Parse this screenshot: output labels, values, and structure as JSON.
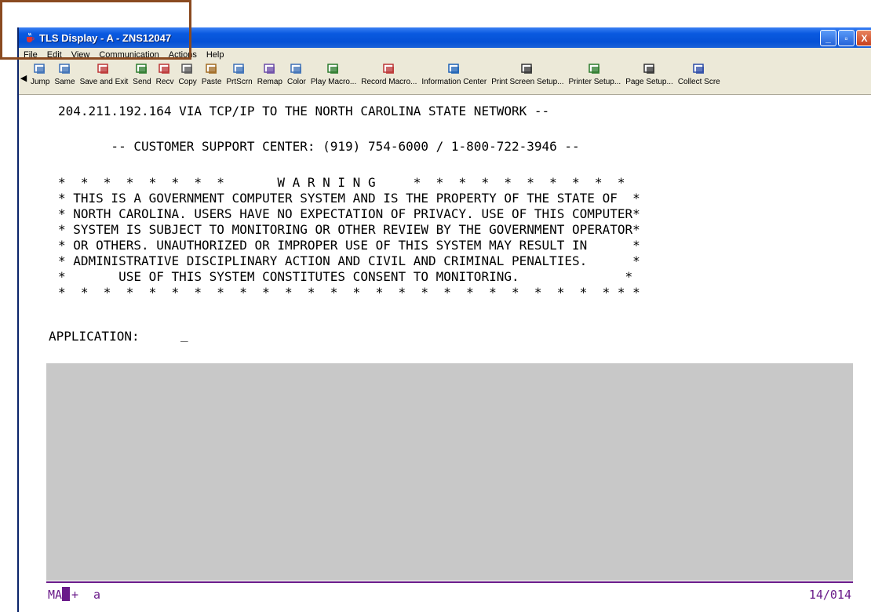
{
  "window": {
    "title": "TLS Display - A - ZNS12047",
    "controls": {
      "minimize": "_",
      "maximize": "▫",
      "close": "X"
    }
  },
  "menubar": [
    "File",
    "Edit",
    "View",
    "Communication",
    "Actions",
    "Help"
  ],
  "toolbar": [
    {
      "label": "Jump",
      "icon": "jump-icon"
    },
    {
      "label": "Same",
      "icon": "same-icon"
    },
    {
      "label": "Save and Exit",
      "icon": "save-exit-icon"
    },
    {
      "label": "Send",
      "icon": "send-icon"
    },
    {
      "label": "Recv",
      "icon": "receive-icon"
    },
    {
      "label": "Copy",
      "icon": "copy-icon"
    },
    {
      "label": "Paste",
      "icon": "paste-icon"
    },
    {
      "label": "PrtScrn",
      "icon": "print-screen-icon"
    },
    {
      "label": "Remap",
      "icon": "remap-icon"
    },
    {
      "label": "Color",
      "icon": "color-icon"
    },
    {
      "label": "Play Macro...",
      "icon": "play-macro-icon"
    },
    {
      "label": "Record Macro...",
      "icon": "record-macro-icon"
    },
    {
      "label": "Information Center",
      "icon": "information-icon"
    },
    {
      "label": "Print Screen Setup...",
      "icon": "print-screen-setup-icon"
    },
    {
      "label": "Printer Setup...",
      "icon": "printer-setup-icon"
    },
    {
      "label": "Page Setup...",
      "icon": "page-setup-icon"
    },
    {
      "label": "Collect Scre",
      "icon": "collect-screen-icon"
    }
  ],
  "terminal": {
    "lines": [
      "204.211.192.164 VIA TCP/IP TO THE NORTH CAROLINA STATE NETWORK --",
      "       -- CUSTOMER SUPPORT CENTER: (919) 754-6000 / 1-800-722-3946 --",
      "*  *  *  *  *  *  *  *       W A R N I N G     *  *  *  *  *  *  *  *  *  *",
      "* THIS IS A GOVERNMENT COMPUTER SYSTEM AND IS THE PROPERTY OF THE STATE OF  *",
      "* NORTH CAROLINA. USERS HAVE NO EXPECTATION OF PRIVACY. USE OF THIS COMPUTER*",
      "* SYSTEM IS SUBJECT TO MONITORING OR OTHER REVIEW BY THE GOVERNMENT OPERATOR*",
      "* OR OTHERS. UNAUTHORIZED OR IMPROPER USE OF THIS SYSTEM MAY RESULT IN      *",
      "* ADMINISTRATIVE DISCIPLINARY ACTION AND CIVIL AND CRIMINAL PENALTIES.      *",
      "*       USE OF THIS SYSTEM CONSTITUTES CONSENT TO MONITORING.              *",
      "*  *  *  *  *  *  *  *  *  *  *  *  *  *  *  *  *  *  *  *  *  *  *  *  * * *"
    ],
    "prompt_label": "APPLICATION:",
    "cursor": "_"
  },
  "status": {
    "mode": "MA",
    "plus": "+",
    "a": "a",
    "position": "14/014"
  },
  "colors": {
    "titlebar": "#0551d6",
    "chrome": "#ece9d8",
    "terminal_gray": "#c8c8c8",
    "status_text": "#6a1b8a",
    "highlight_box": "#8a4a20"
  }
}
